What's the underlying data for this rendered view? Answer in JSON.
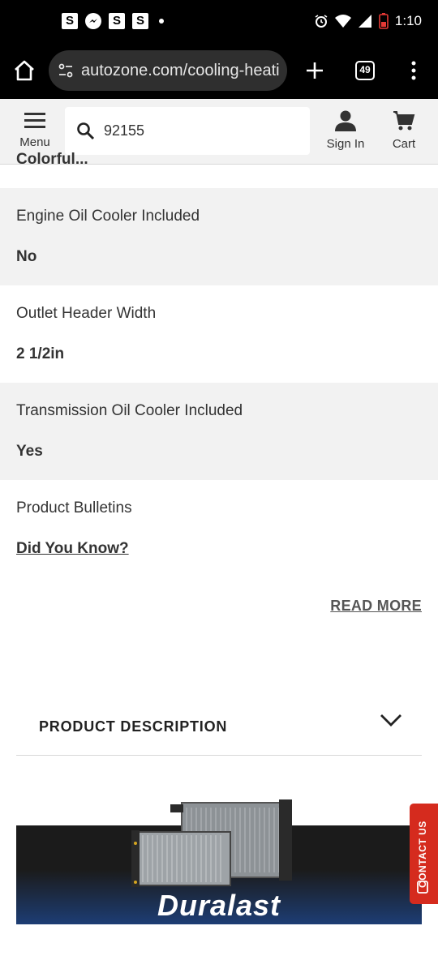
{
  "status_bar": {
    "notif_icons": [
      "S",
      "S",
      "S"
    ],
    "time": "1:10"
  },
  "browser": {
    "url": "autozone.com/cooling-heating",
    "tab_count": "49"
  },
  "header": {
    "menu_label": "Menu",
    "search_value": "92155",
    "signin_label": "Sign In",
    "cart_label": "Cart"
  },
  "specs": {
    "cut_off_value": "Colorful...",
    "rows": [
      {
        "label": "Engine Oil Cooler Included",
        "value": "No"
      },
      {
        "label": "Outlet Header Width",
        "value": "2 1/2in"
      },
      {
        "label": "Transmission Oil Cooler Included",
        "value": "Yes"
      },
      {
        "label": "Product Bulletins",
        "value": "Did You Know?"
      }
    ]
  },
  "read_more": "READ MORE",
  "product_description": "PRODUCT DESCRIPTION",
  "banner": {
    "brand": "Duralast"
  },
  "contact_us": "CONTACT US",
  "colors": {
    "accent_red": "#d52b1e",
    "header_bg": "#f2f2f2",
    "row_gray": "#f2f2f2"
  }
}
